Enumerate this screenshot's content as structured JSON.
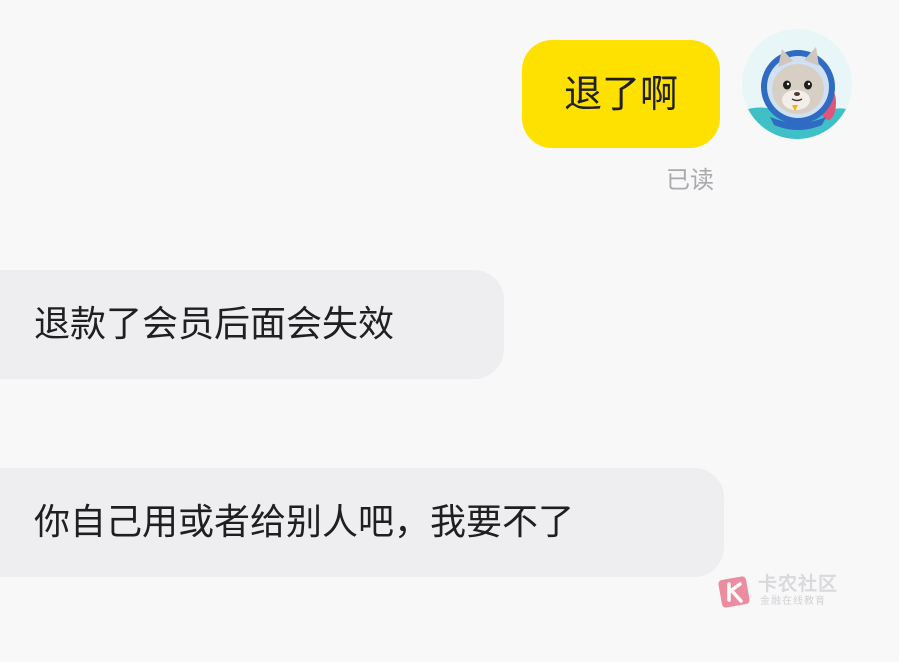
{
  "messages": {
    "self": {
      "text": "退了啊",
      "status": "已读"
    },
    "other": [
      {
        "text": "退款了会员后面会失效"
      },
      {
        "text": "你自己用或者给别人吧，我要不了"
      }
    ]
  },
  "watermark": {
    "title": "卡农社区",
    "subtitle": "金融在线教育"
  },
  "colors": {
    "self_bubble": "#ffe100",
    "other_bubble": "#eeeef1",
    "background": "#f8f8f9",
    "read_receipt": "#a9a9ae"
  },
  "icons": {
    "avatar": "cat-astronaut-avatar-icon",
    "watermark_logo": "kanong-logo-icon"
  }
}
